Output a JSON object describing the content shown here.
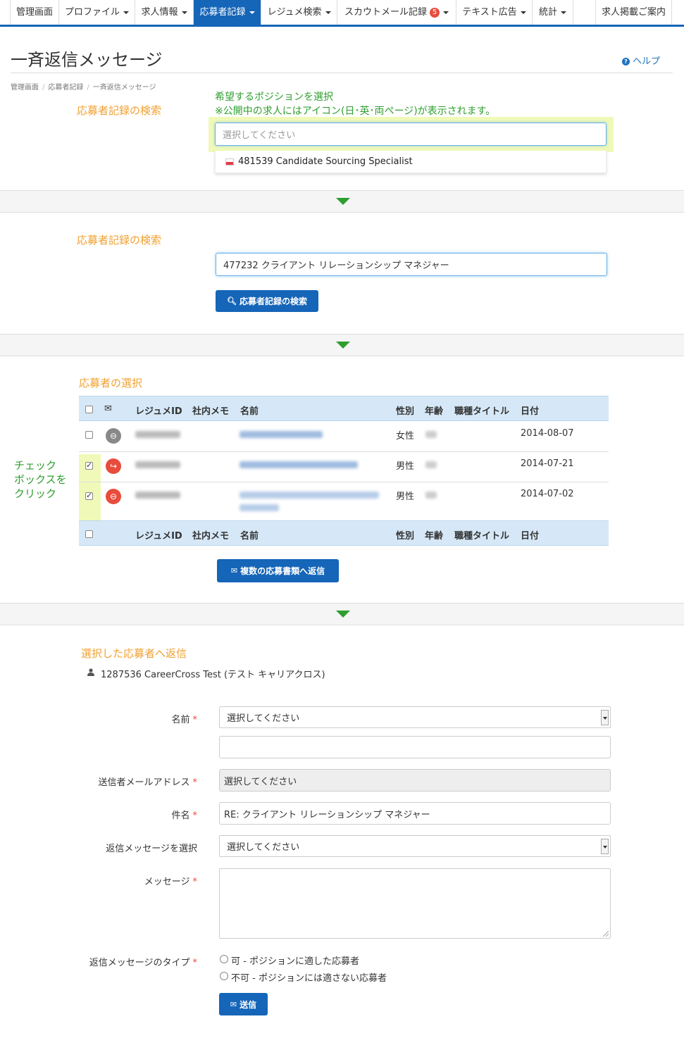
{
  "nav": {
    "items": [
      {
        "label": "管理画面",
        "caret": false
      },
      {
        "label": "プロファイル",
        "caret": true
      },
      {
        "label": "求人情報",
        "caret": true
      },
      {
        "label": "応募者記録",
        "caret": true,
        "active": true
      },
      {
        "label": "レジュメ検索",
        "caret": true
      },
      {
        "label": "スカウトメール記録",
        "caret": true,
        "badge": "5"
      },
      {
        "label": "テキスト広告",
        "caret": true
      },
      {
        "label": "統計",
        "caret": true
      },
      {
        "label": "求人掲載ご案内",
        "caret": false
      }
    ],
    "accent": "#1565b8"
  },
  "page": {
    "title": "一斉返信メッセージ",
    "help": "ヘルプ",
    "breadcrumb": [
      "管理画面",
      "応募者記録",
      "一斉返信メッセージ"
    ]
  },
  "step1": {
    "heading": "応募者記録の検索",
    "note_line1": "希望するポジションを選択",
    "note_line2": "※公開中の求人にはアイコン(日･英･両ページ)が表示されます。",
    "placeholder": "選択してください",
    "option": "481539 Candidate Sourcing Specialist"
  },
  "step2": {
    "heading": "応募者記録の検索",
    "value": "477232 クライアント リレーションシップ マネジャー",
    "button": "応募者記録の検索"
  },
  "step3": {
    "heading": "応募者の選択",
    "columns": {
      "resume_id": "レジュメID",
      "memo": "社内メモ",
      "name": "名前",
      "gender": "性別",
      "age": "年齢",
      "job_title": "職種タイトル",
      "date": "日付"
    },
    "rows": [
      {
        "gender": "女性",
        "date": "2014-08-07",
        "checked": false,
        "status_icon": "ban-icon",
        "status_color": "#888888"
      },
      {
        "gender": "男性",
        "date": "2014-07-21",
        "checked": true,
        "status_icon": "forward-icon",
        "status_color": "#e74c3c"
      },
      {
        "gender": "男性",
        "date": "2014-07-02",
        "checked": true,
        "status_icon": "ban-icon",
        "status_color": "#e74c3c"
      }
    ],
    "click_note_1": "チェック",
    "click_note_2": "ボックスを",
    "click_note_3": "クリック",
    "button": "複数の応募書類へ返信"
  },
  "step4": {
    "heading": "選択した応募者へ返信",
    "recipient": "1287536 CareerCross Test (テスト キャリアクロス)",
    "fields": {
      "name_label": "名前",
      "name_select": "選択してください",
      "sender_label": "送信者メールアドレス",
      "sender_value": "選択してください",
      "subject_label": "件名",
      "subject_value": "RE: クライアント リレーションシップ マネジャー",
      "template_label": "返信メッセージを選択",
      "template_select": "選択してください",
      "message_label": "メッセージ",
      "type_label": "返信メッセージのタイプ",
      "type_option_yes": "可 - ポジションに適した応募者",
      "type_option_no": "不可 - ポジションには適さない応募者"
    },
    "submit": "送信",
    "required_mark": "*"
  }
}
